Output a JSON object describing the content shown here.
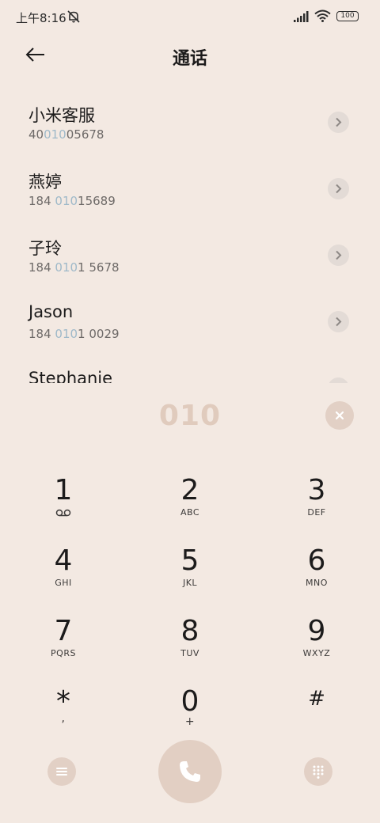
{
  "status_bar": {
    "time": "上午8:16",
    "battery": "100"
  },
  "header": {
    "title": "通话"
  },
  "results": [
    {
      "name": "小米客服",
      "number_pre": "40",
      "number_match": "010",
      "number_post": "05678"
    },
    {
      "name": "燕婷",
      "number_pre": "184 ",
      "number_match": "010",
      "number_post": "15689"
    },
    {
      "name": "子玲",
      "number_pre": "184 ",
      "number_match": "010",
      "number_post": "1 5678"
    },
    {
      "name": "Jason",
      "number_pre": "184 ",
      "number_match": "010",
      "number_post": "1 0029"
    },
    {
      "name": "Stephanie",
      "number_pre": "",
      "number_match": "",
      "number_post": ""
    }
  ],
  "dial_input": {
    "value": "010"
  },
  "keypad": [
    {
      "digit": "1",
      "letters": ""
    },
    {
      "digit": "2",
      "letters": "ABC"
    },
    {
      "digit": "3",
      "letters": "DEF"
    },
    {
      "digit": "4",
      "letters": "GHI"
    },
    {
      "digit": "5",
      "letters": "JKL"
    },
    {
      "digit": "6",
      "letters": "MNO"
    },
    {
      "digit": "7",
      "letters": "PQRS"
    },
    {
      "digit": "8",
      "letters": "TUV"
    },
    {
      "digit": "9",
      "letters": "WXYZ"
    },
    {
      "digit": "*",
      "letters": ","
    },
    {
      "digit": "0",
      "letters": "+"
    },
    {
      "digit": "#",
      "letters": ""
    }
  ],
  "icons": {
    "back": "back-arrow-icon",
    "detail": "chevron-right-icon",
    "clear": "close-icon",
    "menu": "menu-icon",
    "call": "phone-icon",
    "dialpad": "dialpad-icon",
    "voicemail": "voicemail-icon"
  },
  "colors": {
    "background": "#f3e9e2",
    "match_highlight": "#9fb9c9",
    "accent_button": "#e2cfc3",
    "dial_input_text": "#e0cbbd"
  }
}
